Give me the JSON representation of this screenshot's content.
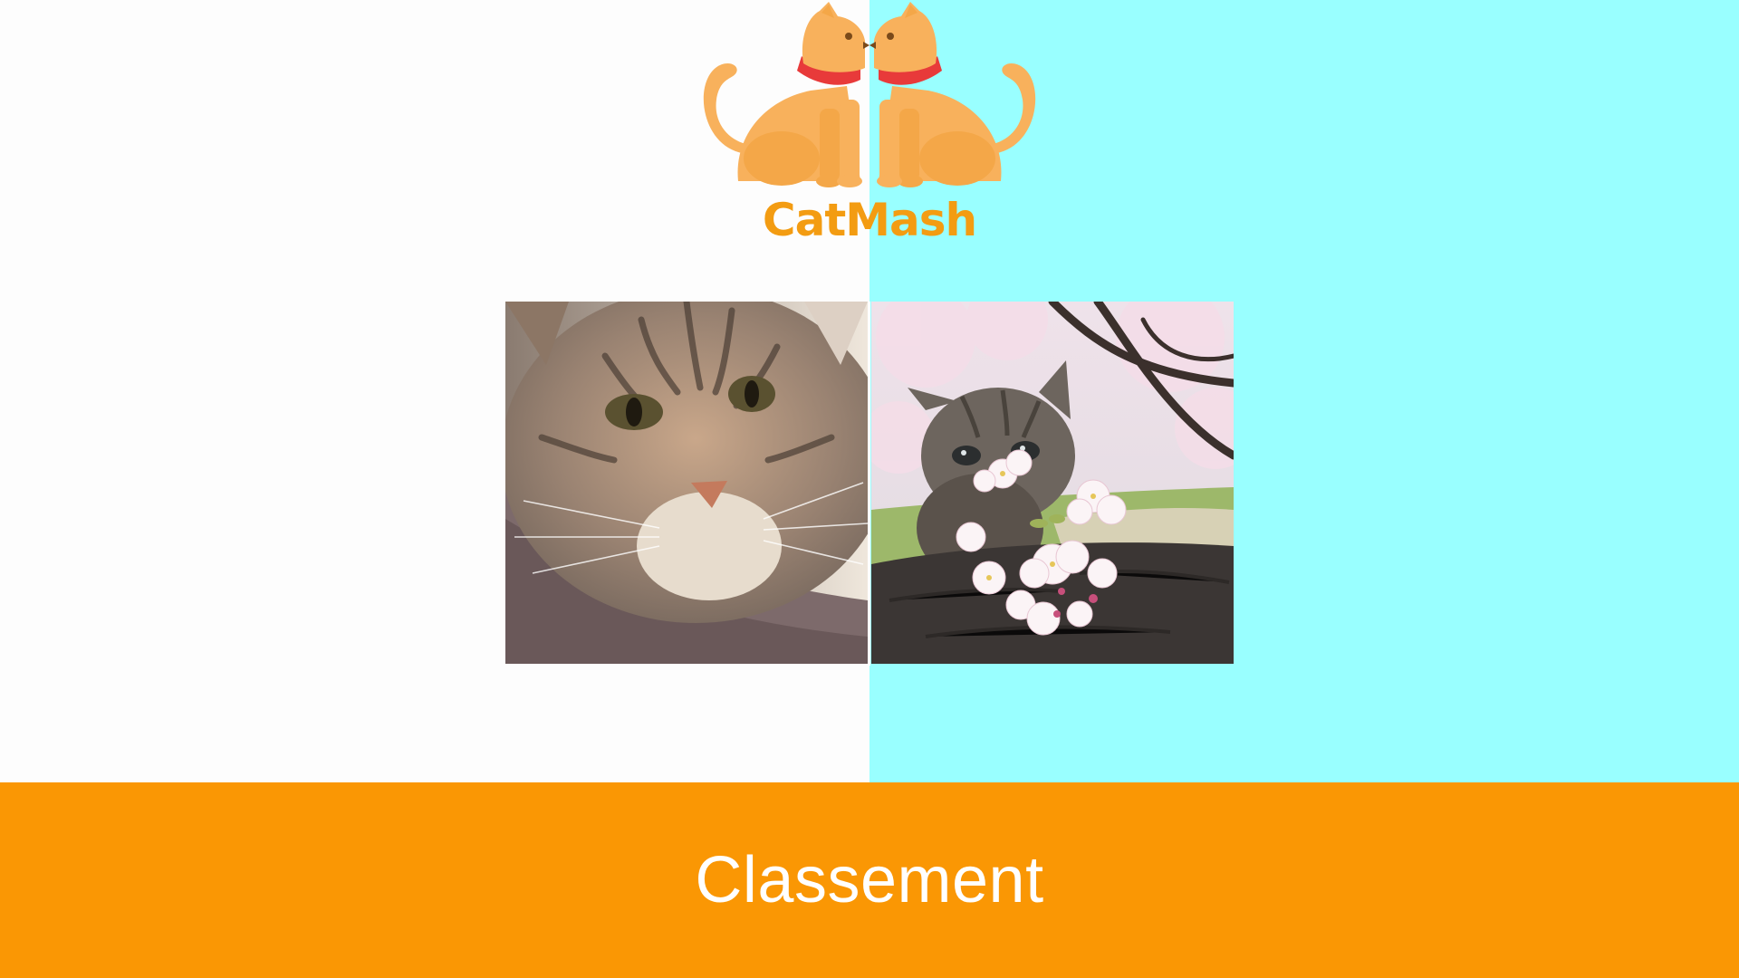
{
  "app": {
    "brand_name": "CatMash",
    "brand_color": "#f39c12"
  },
  "theme": {
    "left_background": "#fdfdfd",
    "right_background": "#99ffff",
    "footer_background": "#fa9704",
    "footer_text_color": "#ffffff"
  },
  "logo": {
    "icon": "twin-cats-logo-icon",
    "cat_color": "#f8b15c",
    "collar_color": "#e83a3a"
  },
  "vote": {
    "left_cat": {
      "icon": "tabby-cat-closeup-photo"
    },
    "right_cat": {
      "icon": "kitten-with-cherry-blossoms-photo"
    }
  },
  "footer": {
    "label": "Classement"
  }
}
